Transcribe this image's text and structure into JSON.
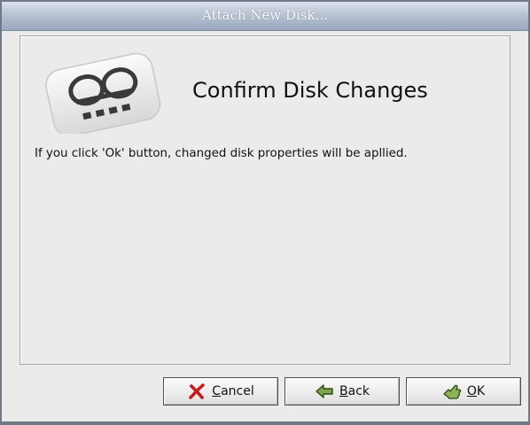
{
  "window": {
    "title": "Attach New Disk..."
  },
  "main": {
    "icon": "disk-icon",
    "heading": "Confirm Disk Changes",
    "message": "If you click 'Ok' button, changed disk properties will be apllied."
  },
  "buttons": {
    "cancel": {
      "mnemonic": "C",
      "rest": "ancel",
      "icon": "cancel-x-icon"
    },
    "back": {
      "mnemonic": "B",
      "rest": "ack",
      "icon": "back-arrow-icon"
    },
    "ok": {
      "mnemonic": "O",
      "rest": "K",
      "icon": "ok-hand-icon"
    }
  },
  "colors": {
    "window_bg": "#ebebeb",
    "titlebar_top": "#d9e1ec",
    "titlebar_bottom": "#9aa8be",
    "title_text": "#ffffff",
    "cancel_icon": "#c41c1c",
    "back_icon": "#6b8f3a"
  }
}
